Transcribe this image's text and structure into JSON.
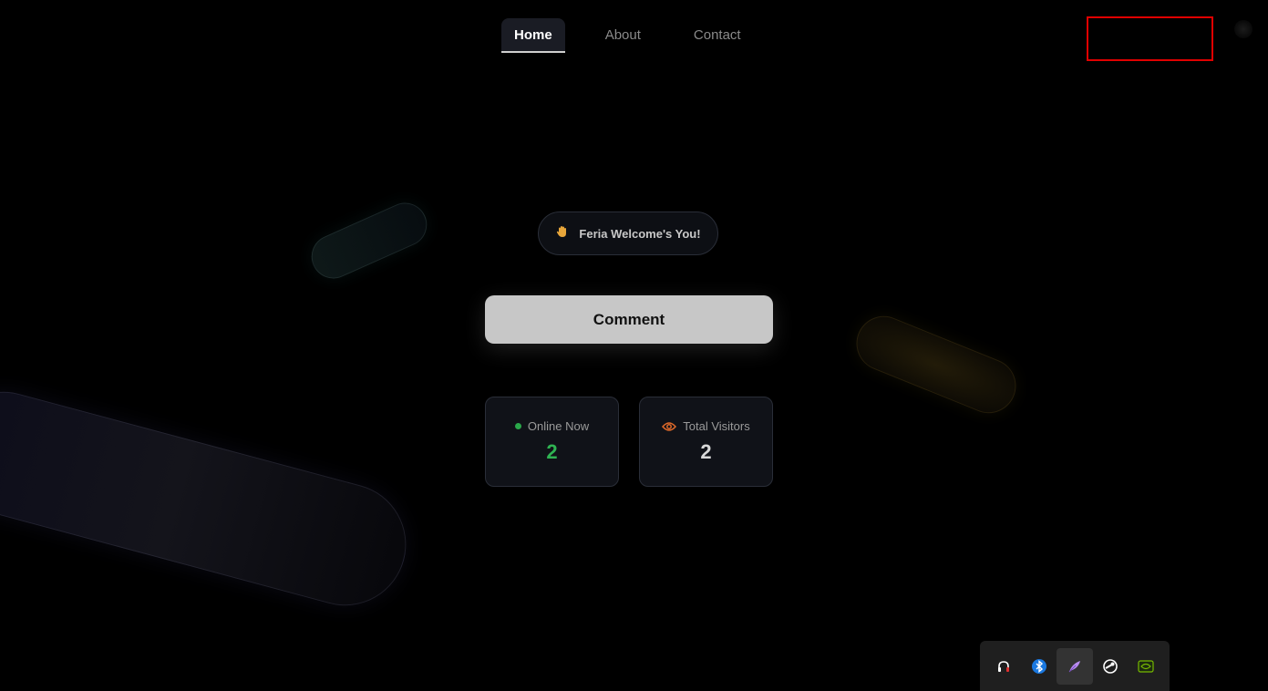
{
  "nav": {
    "items": [
      {
        "label": "Home",
        "active": true
      },
      {
        "label": "About",
        "active": false
      },
      {
        "label": "Contact",
        "active": false
      }
    ]
  },
  "hero": {
    "welcome_text": "Feria Welcome's You!",
    "welcome_icon": "waving-hand-icon",
    "comment_button": "Comment"
  },
  "stats": {
    "online": {
      "label": "Online Now",
      "value": "2",
      "color": "#2fb352"
    },
    "visitors": {
      "label": "Total Visitors",
      "value": "2",
      "icon": "eye-icon",
      "icon_color": "#e06a2a"
    }
  },
  "tray": {
    "icons": [
      "headset-icon",
      "bluetooth-icon",
      "feather-icon",
      "steam-icon",
      "nvidia-icon"
    ]
  },
  "colors": {
    "accent_red": "#e00000",
    "online_green": "#2fb352"
  }
}
